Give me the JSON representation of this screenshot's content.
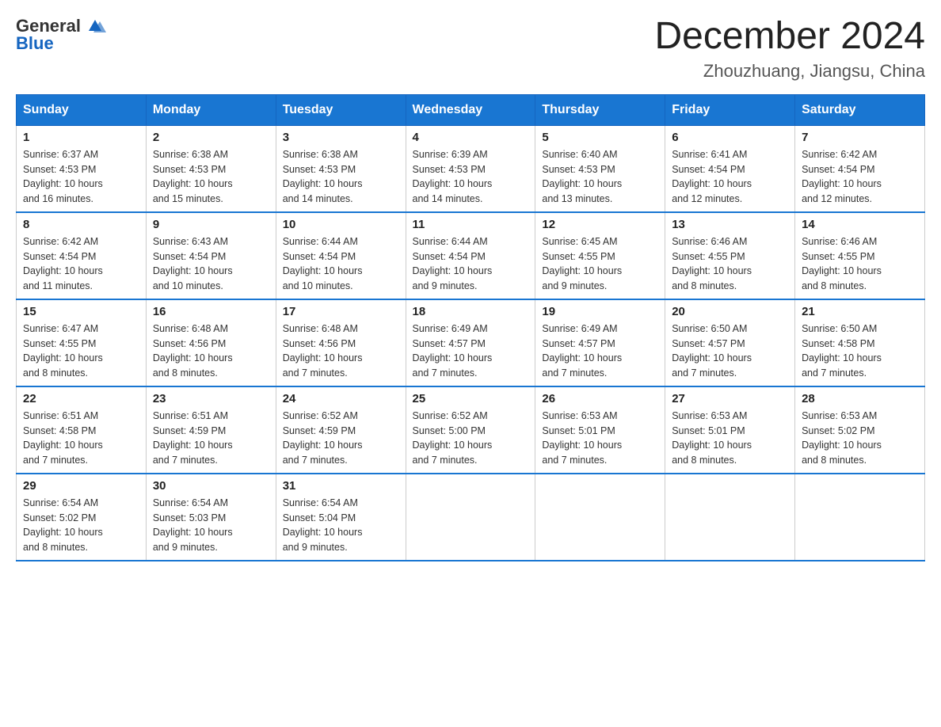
{
  "header": {
    "logo_general": "General",
    "logo_blue": "Blue",
    "month_title": "December 2024",
    "location": "Zhouzhuang, Jiangsu, China"
  },
  "weekdays": [
    "Sunday",
    "Monday",
    "Tuesday",
    "Wednesday",
    "Thursday",
    "Friday",
    "Saturday"
  ],
  "weeks": [
    [
      {
        "day": "1",
        "sunrise": "6:37 AM",
        "sunset": "4:53 PM",
        "daylight": "10 hours and 16 minutes."
      },
      {
        "day": "2",
        "sunrise": "6:38 AM",
        "sunset": "4:53 PM",
        "daylight": "10 hours and 15 minutes."
      },
      {
        "day": "3",
        "sunrise": "6:38 AM",
        "sunset": "4:53 PM",
        "daylight": "10 hours and 14 minutes."
      },
      {
        "day": "4",
        "sunrise": "6:39 AM",
        "sunset": "4:53 PM",
        "daylight": "10 hours and 14 minutes."
      },
      {
        "day": "5",
        "sunrise": "6:40 AM",
        "sunset": "4:53 PM",
        "daylight": "10 hours and 13 minutes."
      },
      {
        "day": "6",
        "sunrise": "6:41 AM",
        "sunset": "4:54 PM",
        "daylight": "10 hours and 12 minutes."
      },
      {
        "day": "7",
        "sunrise": "6:42 AM",
        "sunset": "4:54 PM",
        "daylight": "10 hours and 12 minutes."
      }
    ],
    [
      {
        "day": "8",
        "sunrise": "6:42 AM",
        "sunset": "4:54 PM",
        "daylight": "10 hours and 11 minutes."
      },
      {
        "day": "9",
        "sunrise": "6:43 AM",
        "sunset": "4:54 PM",
        "daylight": "10 hours and 10 minutes."
      },
      {
        "day": "10",
        "sunrise": "6:44 AM",
        "sunset": "4:54 PM",
        "daylight": "10 hours and 10 minutes."
      },
      {
        "day": "11",
        "sunrise": "6:44 AM",
        "sunset": "4:54 PM",
        "daylight": "10 hours and 9 minutes."
      },
      {
        "day": "12",
        "sunrise": "6:45 AM",
        "sunset": "4:55 PM",
        "daylight": "10 hours and 9 minutes."
      },
      {
        "day": "13",
        "sunrise": "6:46 AM",
        "sunset": "4:55 PM",
        "daylight": "10 hours and 8 minutes."
      },
      {
        "day": "14",
        "sunrise": "6:46 AM",
        "sunset": "4:55 PM",
        "daylight": "10 hours and 8 minutes."
      }
    ],
    [
      {
        "day": "15",
        "sunrise": "6:47 AM",
        "sunset": "4:55 PM",
        "daylight": "10 hours and 8 minutes."
      },
      {
        "day": "16",
        "sunrise": "6:48 AM",
        "sunset": "4:56 PM",
        "daylight": "10 hours and 8 minutes."
      },
      {
        "day": "17",
        "sunrise": "6:48 AM",
        "sunset": "4:56 PM",
        "daylight": "10 hours and 7 minutes."
      },
      {
        "day": "18",
        "sunrise": "6:49 AM",
        "sunset": "4:57 PM",
        "daylight": "10 hours and 7 minutes."
      },
      {
        "day": "19",
        "sunrise": "6:49 AM",
        "sunset": "4:57 PM",
        "daylight": "10 hours and 7 minutes."
      },
      {
        "day": "20",
        "sunrise": "6:50 AM",
        "sunset": "4:57 PM",
        "daylight": "10 hours and 7 minutes."
      },
      {
        "day": "21",
        "sunrise": "6:50 AM",
        "sunset": "4:58 PM",
        "daylight": "10 hours and 7 minutes."
      }
    ],
    [
      {
        "day": "22",
        "sunrise": "6:51 AM",
        "sunset": "4:58 PM",
        "daylight": "10 hours and 7 minutes."
      },
      {
        "day": "23",
        "sunrise": "6:51 AM",
        "sunset": "4:59 PM",
        "daylight": "10 hours and 7 minutes."
      },
      {
        "day": "24",
        "sunrise": "6:52 AM",
        "sunset": "4:59 PM",
        "daylight": "10 hours and 7 minutes."
      },
      {
        "day": "25",
        "sunrise": "6:52 AM",
        "sunset": "5:00 PM",
        "daylight": "10 hours and 7 minutes."
      },
      {
        "day": "26",
        "sunrise": "6:53 AM",
        "sunset": "5:01 PM",
        "daylight": "10 hours and 7 minutes."
      },
      {
        "day": "27",
        "sunrise": "6:53 AM",
        "sunset": "5:01 PM",
        "daylight": "10 hours and 8 minutes."
      },
      {
        "day": "28",
        "sunrise": "6:53 AM",
        "sunset": "5:02 PM",
        "daylight": "10 hours and 8 minutes."
      }
    ],
    [
      {
        "day": "29",
        "sunrise": "6:54 AM",
        "sunset": "5:02 PM",
        "daylight": "10 hours and 8 minutes."
      },
      {
        "day": "30",
        "sunrise": "6:54 AM",
        "sunset": "5:03 PM",
        "daylight": "10 hours and 9 minutes."
      },
      {
        "day": "31",
        "sunrise": "6:54 AM",
        "sunset": "5:04 PM",
        "daylight": "10 hours and 9 minutes."
      },
      null,
      null,
      null,
      null
    ]
  ],
  "labels": {
    "sunrise": "Sunrise:",
    "sunset": "Sunset:",
    "daylight": "Daylight:"
  }
}
